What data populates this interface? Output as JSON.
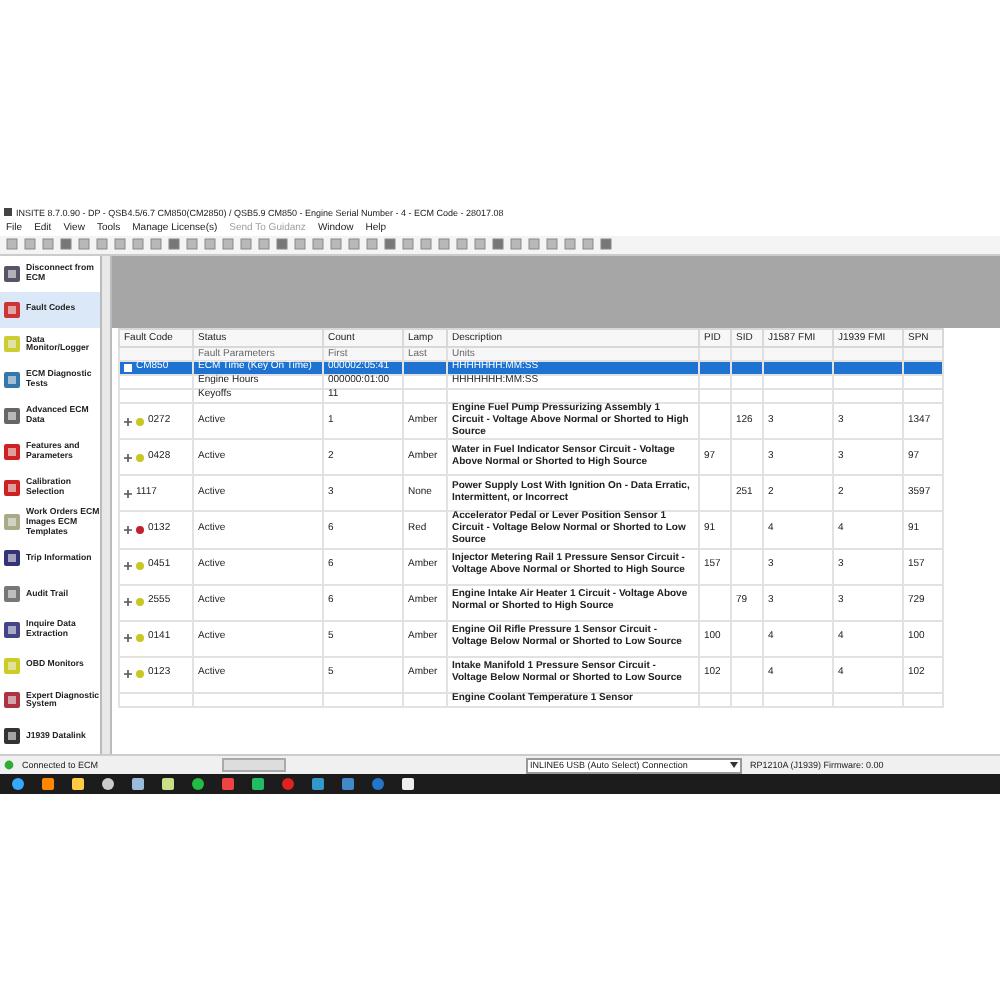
{
  "window": {
    "title": "INSITE 8.7.0.90 - DP - QSB4.5/6.7 CM850(CM2850) / QSB5.9 CM850 - Engine Serial Number - 4 - ECM Code - 28017.08"
  },
  "menu": [
    {
      "label": "File",
      "disabled": false
    },
    {
      "label": "Edit",
      "disabled": false
    },
    {
      "label": "View",
      "disabled": false
    },
    {
      "label": "Tools",
      "disabled": false
    },
    {
      "label": "Manage License(s)",
      "disabled": false
    },
    {
      "label": "Send To Guidanz",
      "disabled": true
    },
    {
      "label": "Window",
      "disabled": false
    },
    {
      "label": "Help",
      "disabled": false
    }
  ],
  "sidebar": {
    "items": [
      {
        "label": "Disconnect from ECM",
        "selected": false
      },
      {
        "label": "Fault Codes",
        "selected": true
      },
      {
        "label": "Data Monitor/Logger",
        "selected": false
      },
      {
        "label": "ECM Diagnostic Tests",
        "selected": false
      },
      {
        "label": "Advanced ECM Data",
        "selected": false
      },
      {
        "label": "Features and Parameters",
        "selected": false
      },
      {
        "label": "Calibration Selection",
        "selected": false
      },
      {
        "label": "Work Orders ECM Images ECM Templates",
        "selected": false
      },
      {
        "label": "Trip Information",
        "selected": false
      },
      {
        "label": "Audit Trail",
        "selected": false
      },
      {
        "label": "Inquire Data Extraction",
        "selected": false
      },
      {
        "label": "OBD Monitors",
        "selected": false
      },
      {
        "label": "Expert Diagnostic System",
        "selected": false
      },
      {
        "label": "J1939 Datalink",
        "selected": false
      }
    ]
  },
  "table": {
    "columns": [
      {
        "label": "Fault Code"
      },
      {
        "label": "Status",
        "sublabel": "Fault Parameters"
      },
      {
        "label": "Count",
        "sublabel": "First"
      },
      {
        "label": "Lamp",
        "sublabel": "Last"
      },
      {
        "label": "Description",
        "sublabel": "Units"
      },
      {
        "label": "PID"
      },
      {
        "label": "SID"
      },
      {
        "label": "J1587 FMI"
      },
      {
        "label": "J1939 FMI"
      },
      {
        "label": "SPN"
      }
    ],
    "rows": [
      {
        "kind": "parameter",
        "selected": true,
        "code": "CM850",
        "status": "ECM Time (Key On Time)",
        "count": "000002:05:41",
        "description": "HHHHHHH:MM:SS"
      },
      {
        "kind": "parameter",
        "selected": false,
        "status": "Engine Hours",
        "count": "000000:01:00",
        "description": "HHHHHHH:MM:SS"
      },
      {
        "kind": "parameter",
        "selected": false,
        "status": "Keyoffs",
        "count": "11"
      },
      {
        "kind": "fault",
        "selected": false,
        "color": "#c8c820",
        "code": "0272",
        "status": "Active",
        "count": "1",
        "lamp": "Amber",
        "description": "Engine Fuel Pump Pressurizing Assembly 1 Circuit - Voltage Above Normal or Shorted to High Source",
        "sid": "126",
        "j1587": "3",
        "j1939": "3",
        "spn": "1347"
      },
      {
        "kind": "fault",
        "selected": false,
        "color": "#c8c820",
        "code": "0428",
        "status": "Active",
        "count": "2",
        "lamp": "Amber",
        "description": "Water in Fuel Indicator Sensor Circuit - Voltage Above Normal or Shorted to High Source",
        "pid": "97",
        "j1587": "3",
        "j1939": "3",
        "spn": "97"
      },
      {
        "kind": "fault",
        "selected": false,
        "code": "1117",
        "status": "Active",
        "count": "3",
        "lamp": "None",
        "description": "Power Supply Lost With Ignition On - Data Erratic, Intermittent, or Incorrect",
        "sid": "251",
        "j1587": "2",
        "j1939": "2",
        "spn": "3597"
      },
      {
        "kind": "fault",
        "selected": false,
        "color": "#c02030",
        "code": "0132",
        "status": "Active",
        "count": "6",
        "lamp": "Red",
        "description": "Accelerator Pedal or Lever Position Sensor 1 Circuit - Voltage Below Normal or Shorted to Low Source",
        "pid": "91",
        "j1587": "4",
        "j1939": "4",
        "spn": "91"
      },
      {
        "kind": "fault",
        "selected": false,
        "color": "#c8c820",
        "code": "0451",
        "status": "Active",
        "count": "6",
        "lamp": "Amber",
        "description": "Injector Metering Rail 1 Pressure Sensor Circuit - Voltage Above Normal or Shorted to High Source",
        "pid": "157",
        "j1587": "3",
        "j1939": "3",
        "spn": "157"
      },
      {
        "kind": "fault",
        "selected": false,
        "color": "#c8c820",
        "code": "2555",
        "status": "Active",
        "count": "6",
        "lamp": "Amber",
        "description": "Engine Intake Air Heater 1 Circuit - Voltage Above Normal or Shorted to High Source",
        "sid": "79",
        "j1587": "3",
        "j1939": "3",
        "spn": "729"
      },
      {
        "kind": "fault",
        "selected": false,
        "color": "#c8c820",
        "code": "0141",
        "status": "Active",
        "count": "5",
        "lamp": "Amber",
        "description": "Engine Oil Rifle Pressure 1 Sensor Circuit - Voltage Below Normal or Shorted to Low Source",
        "pid": "100",
        "j1587": "4",
        "j1939": "4",
        "spn": "100"
      },
      {
        "kind": "fault",
        "selected": false,
        "color": "#c8c820",
        "code": "0123",
        "status": "Active",
        "count": "5",
        "lamp": "Amber",
        "description": "Intake Manifold 1 Pressure Sensor Circuit - Voltage Below Normal or Shorted to Low Source",
        "pid": "102",
        "j1587": "4",
        "j1939": "4",
        "spn": "102"
      },
      {
        "kind": "fault",
        "selected": false,
        "description": "Engine Coolant Temperature 1 Sensor"
      }
    ]
  },
  "status_bar": {
    "connection": "Connected to ECM",
    "adapter": "INLINE6 USB (Auto Select) Connection",
    "firmware": "RP1210A (J1939) Firmware: 0.00"
  }
}
